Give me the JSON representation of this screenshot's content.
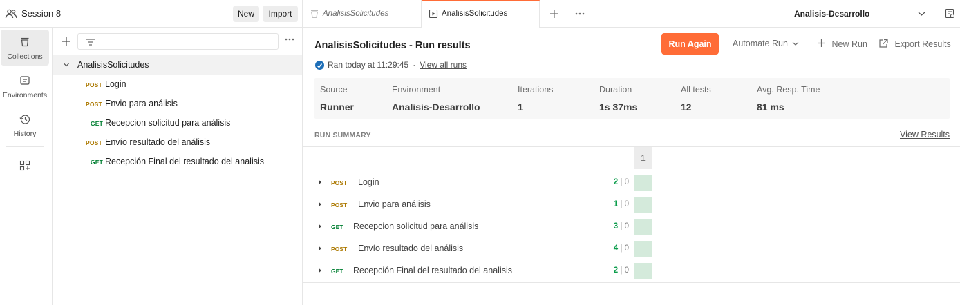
{
  "workspace": {
    "title": "Session 8",
    "new_label": "New",
    "import_label": "Import"
  },
  "rail": {
    "items": [
      {
        "label": "Collections",
        "icon": "collections-icon"
      },
      {
        "label": "Environments",
        "icon": "environments-icon"
      },
      {
        "label": "History",
        "icon": "history-icon"
      }
    ]
  },
  "collection": {
    "name": "AnalisisSolicitudes",
    "requests": [
      {
        "method": "POST",
        "name": "Login"
      },
      {
        "method": "POST",
        "name": "Envio para análisis"
      },
      {
        "method": "GET",
        "name": "Recepcion solicitud para análisis"
      },
      {
        "method": "POST",
        "name": "Envío resultado del análisis"
      },
      {
        "method": "GET",
        "name": "Recepción Final del resultado del analisis"
      }
    ]
  },
  "tabs": [
    {
      "label": "AnalisisSolicitudes",
      "icon": "collection-tab-icon",
      "active": false
    },
    {
      "label": "AnalisisSolicitudes",
      "icon": "runner-tab-icon",
      "active": true
    }
  ],
  "environment": {
    "selected": "Analisis-Desarrollo"
  },
  "run": {
    "title": "AnalisisSolicitudes - Run results",
    "meta_text": "Ran today at 11:29:45",
    "meta_sep": "·",
    "view_all_runs": "View all runs",
    "run_again_label": "Run Again",
    "automate_label": "Automate Run",
    "new_run_label": "New Run",
    "export_label": "Export Results",
    "stats": {
      "source": {
        "label": "Source",
        "value": "Runner"
      },
      "environment": {
        "label": "Environment",
        "value": "Analisis-Desarrollo"
      },
      "iterations": {
        "label": "Iterations",
        "value": "1"
      },
      "duration": {
        "label": "Duration",
        "value": "1s 37ms"
      },
      "all_tests": {
        "label": "All tests",
        "value": "12"
      },
      "avg_resp": {
        "label": "Avg. Resp. Time",
        "value": "81 ms"
      }
    },
    "summary_label": "RUN SUMMARY",
    "view_results_label": "View Results",
    "iteration_header": "1",
    "summary_rows": [
      {
        "method": "POST",
        "name": "Login",
        "passed": "2",
        "failed": "0"
      },
      {
        "method": "POST",
        "name": "Envio para análisis",
        "passed": "1",
        "failed": "0"
      },
      {
        "method": "GET",
        "name": "Recepcion solicitud para análisis",
        "passed": "3",
        "failed": "0"
      },
      {
        "method": "POST",
        "name": "Envío resultado del análisis",
        "passed": "4",
        "failed": "0"
      },
      {
        "method": "GET",
        "name": "Recepción Final del resultado del analisis",
        "passed": "2",
        "failed": "0"
      }
    ],
    "sep_char": "|"
  },
  "colors": {
    "accent": "#ff6c37",
    "post": "#ad7a03",
    "get": "#007f31",
    "pass": "#0c9d4c",
    "iteration_pass_fill": "#d4eadb"
  }
}
